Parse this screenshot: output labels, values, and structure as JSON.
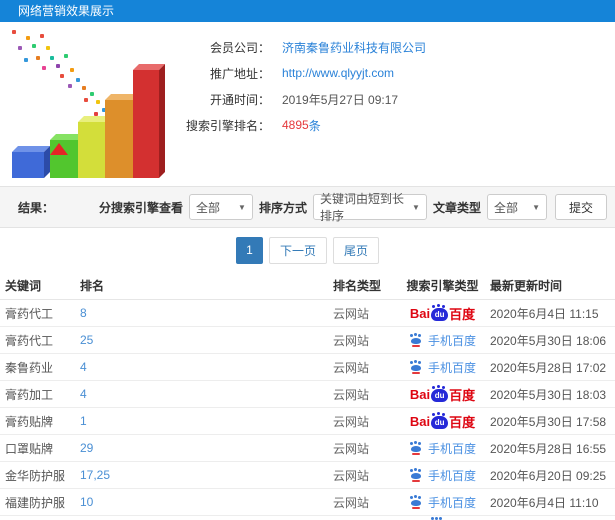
{
  "header": {
    "title": "网络营销效果展示"
  },
  "company": {
    "fields": [
      {
        "label": "会员公司：",
        "value": "济南秦鲁药业科技有限公司"
      },
      {
        "label": "推广地址：",
        "value": "http://www.qlyyjt.com"
      },
      {
        "label": "开通时间：",
        "value": "2019年5月27日 09:17"
      },
      {
        "label": "搜索引擎排名：",
        "value": "4895",
        "suffix": "条"
      }
    ]
  },
  "filters": {
    "section_label": "结果：",
    "engine_view_label": "分搜索引擎查看",
    "engine_view_value": "全部",
    "sort_label": "排序方式",
    "sort_value": "关键词由短到长排序",
    "article_type_label": "文章类型",
    "article_type_value": "全部",
    "submit_label": "提交",
    "dropdown_arrow": "▼"
  },
  "pagination": {
    "current": "1",
    "next_label": "下一页",
    "last_label": "尾页"
  },
  "table": {
    "headers": {
      "keyword": "关键词",
      "rank": "排名",
      "rank_type": "排名类型",
      "engine_type": "搜索引擎类型",
      "updated": "最新更新时间"
    },
    "rows": [
      {
        "keyword": "膏药代工",
        "rank": "8",
        "type": "云网站",
        "engine": "百度",
        "engine_kind": "baidu-pc",
        "time": "2020年6月4日 11:15"
      },
      {
        "keyword": "膏药代工",
        "rank": "25",
        "type": "云网站",
        "engine": "手机百度",
        "engine_kind": "baidu-mobile",
        "time": "2020年5月30日 18:06"
      },
      {
        "keyword": "秦鲁药业",
        "rank": "4",
        "type": "云网站",
        "engine": "手机百度",
        "engine_kind": "baidu-mobile",
        "time": "2020年5月28日 17:02"
      },
      {
        "keyword": "膏药加工",
        "rank": "4",
        "type": "云网站",
        "engine": "百度",
        "engine_kind": "baidu-pc",
        "time": "2020年5月30日 18:03"
      },
      {
        "keyword": "膏药贴牌",
        "rank": "1",
        "type": "云网站",
        "engine": "百度",
        "engine_kind": "baidu-pc",
        "time": "2020年5月30日 17:58"
      },
      {
        "keyword": "口罩贴牌",
        "rank": "29",
        "type": "云网站",
        "engine": "手机百度",
        "engine_kind": "baidu-mobile",
        "time": "2020年5月28日 16:55"
      },
      {
        "keyword": "金华防护服",
        "rank": "17,25",
        "type": "云网站",
        "engine": "手机百度",
        "engine_kind": "baidu-mobile",
        "time": "2020年6月20日 09:25"
      },
      {
        "keyword": "福建防护服",
        "rank": "10",
        "type": "云网站",
        "engine": "手机百度",
        "engine_kind": "baidu-mobile",
        "time": "2020年6月4日 11:10"
      }
    ]
  },
  "baidu_logo": {
    "bai": "Bai",
    "du": "du",
    "cn": "百度"
  },
  "colors": {
    "header_bg": "#1584d8",
    "link_blue": "#2a82d8",
    "rank_blue": "#4a8fd4",
    "highlight_red": "#e4393c",
    "pagination_active": "#337ab7",
    "baidu_red": "#de0612",
    "baidu_paw_blue": "#2529d8",
    "mobile_baidu_blue": "#4a90e2"
  }
}
